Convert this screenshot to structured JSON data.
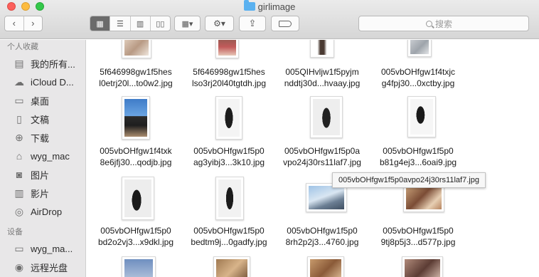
{
  "window": {
    "title": "girlimage"
  },
  "toolbar": {
    "back_icon": "chevron-left-icon",
    "forward_icon": "chevron-right-icon",
    "search_placeholder": "搜索"
  },
  "sidebar": {
    "favorites_header": "个人收藏",
    "favorites": [
      {
        "label": "我的所有...",
        "icon": "all-files-icon"
      },
      {
        "label": "iCloud D...",
        "icon": "cloud-icon"
      },
      {
        "label": "桌面",
        "icon": "desktop-icon"
      },
      {
        "label": "文稿",
        "icon": "document-icon"
      },
      {
        "label": "下载",
        "icon": "download-icon"
      },
      {
        "label": "wyg_mac",
        "icon": "home-icon"
      },
      {
        "label": "图片",
        "icon": "camera-icon"
      },
      {
        "label": "影片",
        "icon": "film-icon"
      },
      {
        "label": "AirDrop",
        "icon": "airdrop-icon"
      }
    ],
    "devices_header": "设备",
    "devices": [
      {
        "label": "wyg_ma...",
        "icon": "laptop-icon"
      },
      {
        "label": "远程光盘",
        "icon": "disc-icon"
      }
    ]
  },
  "files": [
    {
      "line1": "5f646998gw1f5hes",
      "line2": "l0etrj20l...to0w2.jpg"
    },
    {
      "line1": "5f646998gw1f5hes",
      "line2": "lso3rj20l40tgtdh.jpg"
    },
    {
      "line1": "005QIHvljw1f5pyjm",
      "line2": "nddtj30d...hvaay.jpg"
    },
    {
      "line1": "005vbOHfgw1f4txjc",
      "line2": "g4fpj30...0xctby.jpg"
    },
    {
      "line1": "005vbOHfgw1f4txk",
      "line2": "8e6jfj30...qodjb.jpg"
    },
    {
      "line1": "005vbOHfgw1f5p0",
      "line2": "ag3yibj3...3k10.jpg"
    },
    {
      "line1": "005vbOHfgw1f5p0a",
      "line2": "vpo24j30rs11laf7.jpg"
    },
    {
      "line1": "005vbOHfgw1f5p0",
      "line2": "b81g4ej3...6oai9.jpg"
    },
    {
      "line1": "005vbOHfgw1f5p0",
      "line2": "bd2o2vj3...x9dkl.jpg"
    },
    {
      "line1": "005vbOHfgw1f5p0",
      "line2": "bedtm9j...0gadfy.jpg"
    },
    {
      "line1": "005vbOHfgw1f5p0",
      "line2": "8rh2p2j3...4760.jpg"
    },
    {
      "line1": "005vbOHfgw1f5p0",
      "line2": "9tj8p5j3...d577p.jpg"
    }
  ],
  "tooltip": "005vbOHfgw1f5p0avpo24j30rs11laf7.jpg",
  "colors": {
    "sidebar_bg": "#e8e7e8",
    "selected_view": "#6b6b6b",
    "folder_blue": "#5ab1f0"
  }
}
